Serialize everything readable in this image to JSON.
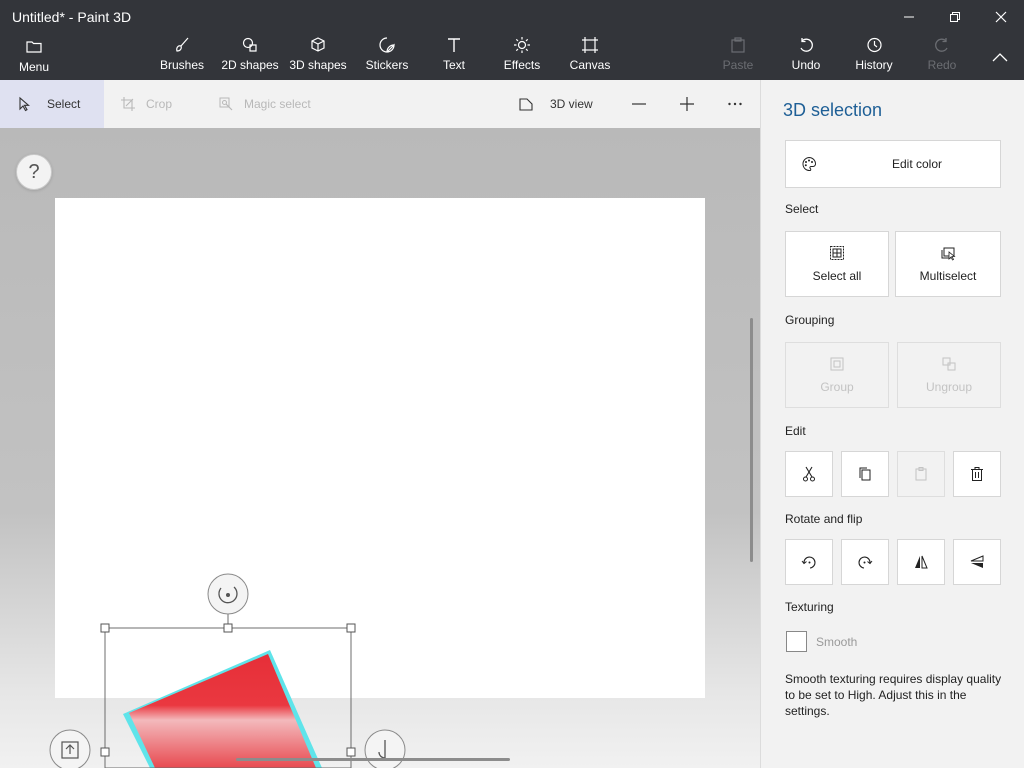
{
  "window": {
    "title": "Untitled* - Paint 3D",
    "minimize_icon": "minimize-icon",
    "maximize_icon": "maximize-icon",
    "close_icon": "close-icon"
  },
  "ribbon": {
    "menu": "Menu",
    "brushes": "Brushes",
    "shapes_2d": "2D shapes",
    "shapes_3d": "3D shapes",
    "stickers": "Stickers",
    "text": "Text",
    "effects": "Effects",
    "canvas": "Canvas",
    "paste": "Paste",
    "undo": "Undo",
    "history": "History",
    "redo": "Redo"
  },
  "toolbar": {
    "select": "Select",
    "crop": "Crop",
    "magic_select": "Magic select",
    "view_3d": "3D view"
  },
  "panel": {
    "title": "3D selection",
    "edit_color": "Edit color",
    "select_heading": "Select",
    "select_all": "Select all",
    "multiselect": "Multiselect",
    "grouping_heading": "Grouping",
    "group": "Group",
    "ungroup": "Ungroup",
    "edit_heading": "Edit",
    "rotate_heading": "Rotate and flip",
    "texturing_heading": "Texturing",
    "smooth": "Smooth",
    "smooth_note": "Smooth texturing requires display quality to be set to High. Adjust this in the settings."
  },
  "canvas": {
    "help": "?",
    "shape_color": "#e8343c",
    "outline_color": "#5fe4ea"
  },
  "colors": {
    "titlebar": "#33353a",
    "accent": "#1e5f96",
    "select_active": "#dfe1f1"
  }
}
